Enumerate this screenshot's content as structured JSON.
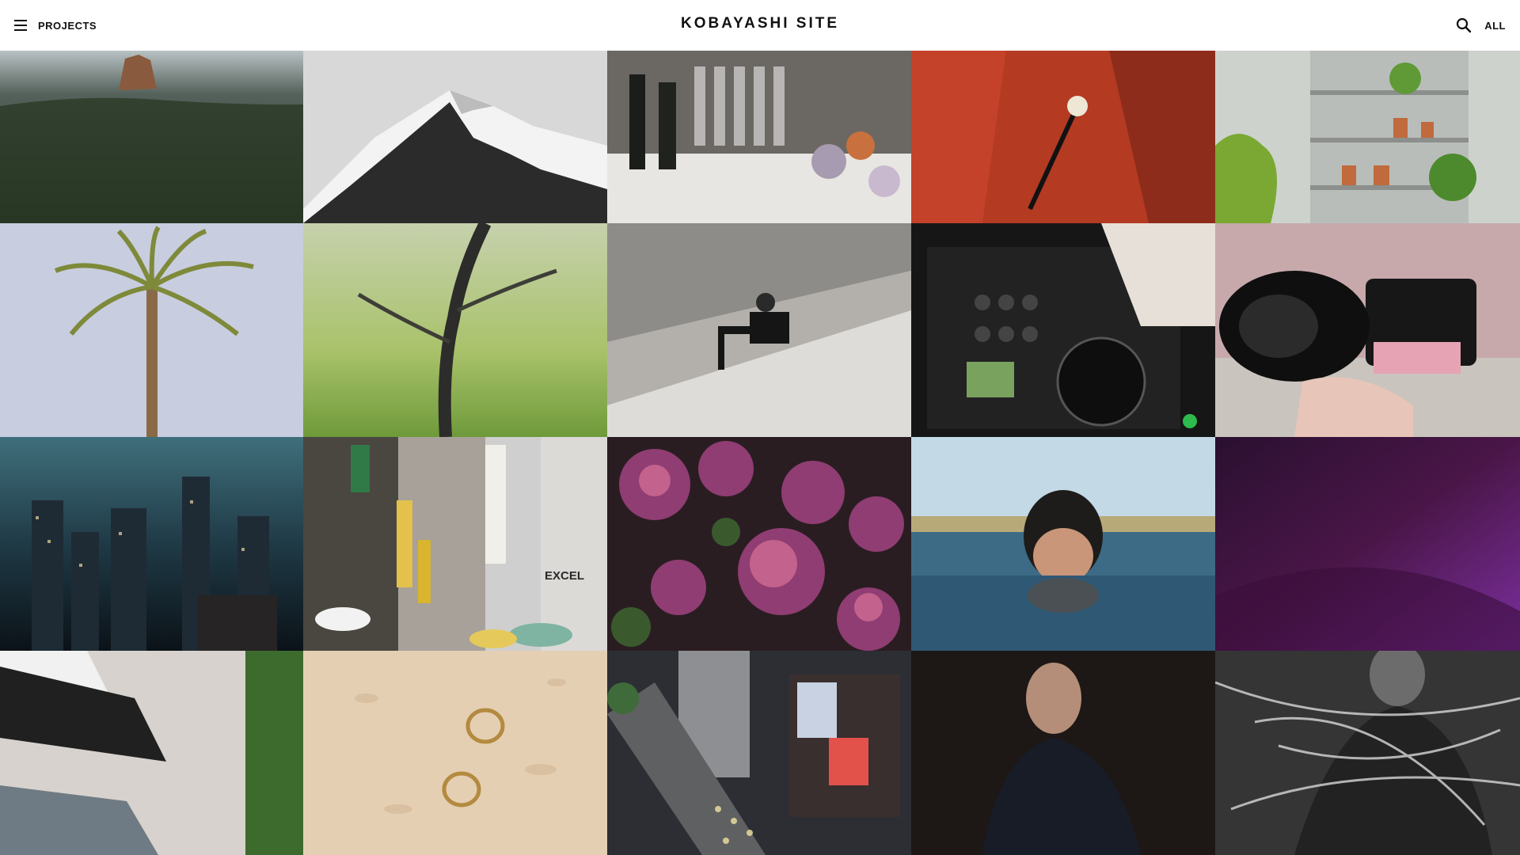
{
  "header": {
    "menu_label": "PROJECTS",
    "site_title": "KOBAYASHI SITE",
    "filter_label": "ALL",
    "menu_icon": "hamburger-menu-icon",
    "search_icon": "search-icon"
  },
  "colors": {
    "header_bg": "#ffffff",
    "text": "#111111"
  },
  "gallery": {
    "sign_text": "EXCEL",
    "tiles": [
      {
        "subject": "aerial misty forest with rock mountain"
      },
      {
        "subject": "snowy mountain peak"
      },
      {
        "subject": "wine bottles glasses and flowers"
      },
      {
        "subject": "red car interior gear shift"
      },
      {
        "subject": "shelf with potted plants"
      },
      {
        "subject": "palm tree against sky"
      },
      {
        "subject": "blurred birch tree"
      },
      {
        "subject": "man leaning over concrete wall"
      },
      {
        "subject": "dj mixer controller"
      },
      {
        "subject": "hand holding camera"
      },
      {
        "subject": "city skyline at night"
      },
      {
        "subject": "tokyo street signs"
      },
      {
        "subject": "lilac flowers"
      },
      {
        "subject": "woman in water"
      },
      {
        "subject": "purple aurora sky"
      },
      {
        "subject": "modern building facade"
      },
      {
        "subject": "two rings on stone"
      },
      {
        "subject": "aerial city crossing"
      },
      {
        "subject": "man portrait dark background"
      },
      {
        "subject": "person wrapped in plastic"
      }
    ]
  }
}
